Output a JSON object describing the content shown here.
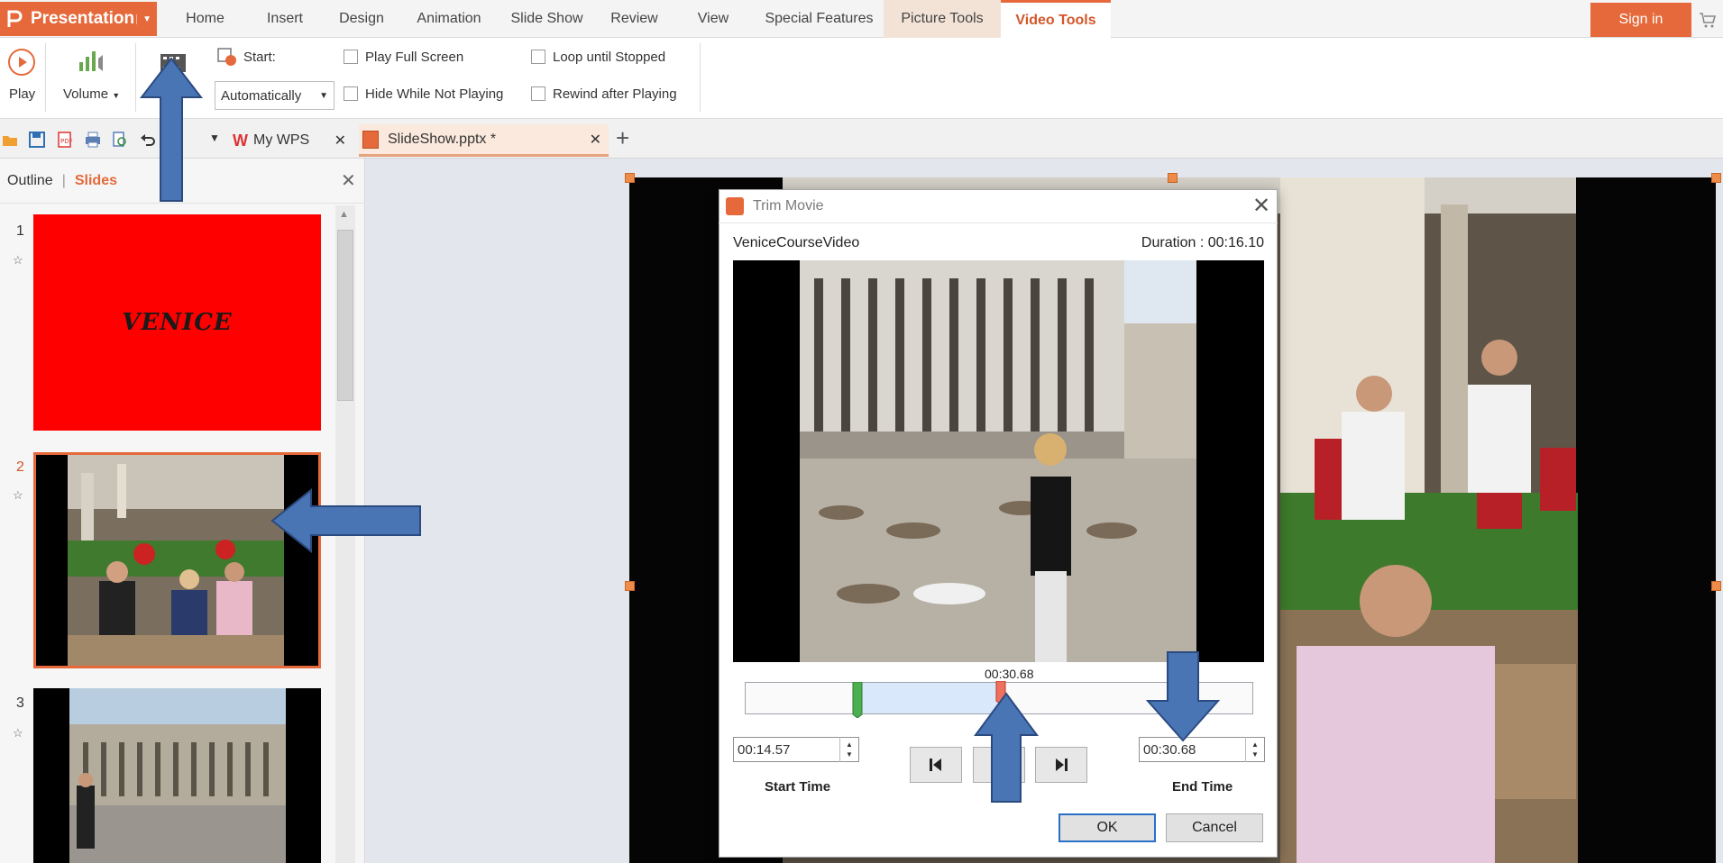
{
  "app": {
    "name": "Presentation"
  },
  "menu": {
    "tabs": [
      "Home",
      "Insert",
      "Design",
      "Animation",
      "Slide Show",
      "Review",
      "View",
      "Special Features",
      "Picture Tools",
      "Video Tools"
    ],
    "active_tab": "Video Tools",
    "sign_in": "Sign in"
  },
  "ribbon": {
    "play": "Play",
    "volume": "Volume",
    "start_label": "Start:",
    "start_value": "Automatically",
    "play_full_screen": "Play Full Screen",
    "hide_while_not_playing": "Hide While Not Playing",
    "loop_until_stopped": "Loop until Stopped",
    "rewind_after_playing": "Rewind after Playing"
  },
  "doc_tabs": [
    {
      "label": "My WPS"
    },
    {
      "label": "SlideShow.pptx *"
    }
  ],
  "left_panel": {
    "tab_outline": "Outline",
    "tab_slides": "Slides",
    "slides": [
      {
        "number": "1",
        "title_text": "VENICE"
      },
      {
        "number": "2"
      },
      {
        "number": "3"
      }
    ],
    "selected_slide": 2
  },
  "dialog": {
    "title": "Trim Movie",
    "video_name": "VeniceCourseVideo",
    "duration": "Duration : 00:16.10",
    "current_time": "00:30.68",
    "start_time_value": "00:14.57",
    "end_time_value": "00:30.68",
    "start_time_label": "Start Time",
    "end_time_label": "End Time",
    "ok": "OK",
    "cancel": "Cancel",
    "selection_start_fraction": 0.18,
    "selection_end_fraction": 0.46
  },
  "colors": {
    "accent": "#e5693a",
    "annotation_arrow": "#4a75b5",
    "slide1_background": "#ff0000"
  }
}
